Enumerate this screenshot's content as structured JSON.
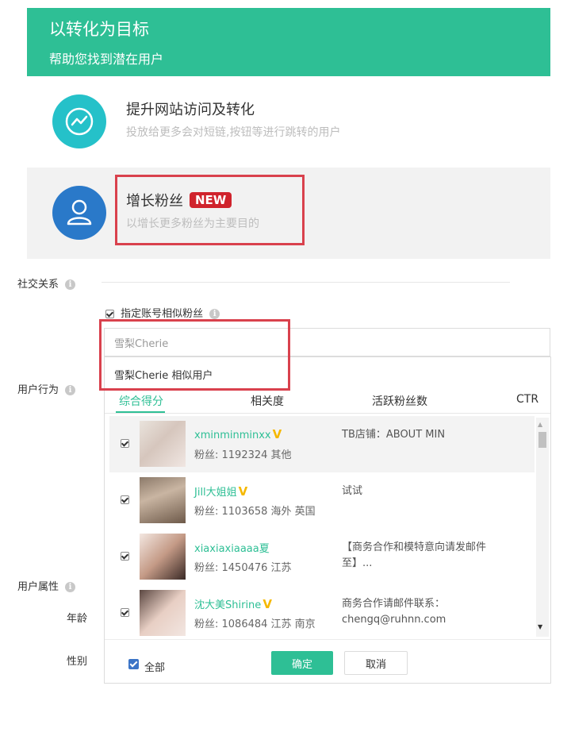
{
  "goal": {
    "title": "以转化为目标",
    "subtitle": "帮助您找到潜在用户",
    "options": [
      {
        "title": "提升网站访问及转化",
        "desc": "投放给更多会对短链,按钮等进行跳转的用户",
        "icon": "trend-icon",
        "color": "#25c1c9"
      },
      {
        "title": "增长粉丝",
        "badge": "NEW",
        "desc": "以增长更多粉丝为主要目的",
        "icon": "user-icon",
        "color": "#2a79c9",
        "selected": true
      }
    ]
  },
  "form": {
    "social_label": "社交关系",
    "behavior_label": "用户行为",
    "attr_label": "用户属性",
    "age_label": "年龄",
    "gender_label": "性别",
    "similar_checkbox_label": "指定账号相似粉丝",
    "search_value": "雪梨Cherie",
    "suggestion": "雪梨Cherie 相似用户"
  },
  "dropdown": {
    "columns": [
      "综合得分",
      "相关度",
      "活跃粉丝数",
      "CTR"
    ],
    "active_column": "综合得分",
    "rows": [
      {
        "name": "xminminminxx",
        "verified": true,
        "fans": "粉丝: 1192324 其他",
        "desc": "TB店铺：ABOUT MIN",
        "checked": true
      },
      {
        "name": "Jill大姐姐",
        "verified": true,
        "fans": "粉丝: 1103658 海外 英国",
        "desc": "试试",
        "checked": true
      },
      {
        "name": "xiaxiaxiaaaa夏",
        "verified": false,
        "fans": "粉丝: 1450476 江苏",
        "desc": "【商务合作和模特意向请发邮件至】...",
        "checked": true
      },
      {
        "name": "沈大美Shirine",
        "verified": true,
        "fans": "粉丝: 1086484 江苏 南京",
        "desc": "商务合作请邮件联系：chengq@ruhnn.com",
        "checked": true
      }
    ],
    "select_all_label": "全部",
    "ok_label": "确定",
    "cancel_label": "取消"
  },
  "colors": {
    "accent": "#2ebf95",
    "highlight_box": "#d9414d",
    "verified": "#f5b800",
    "new_badge": "#d0232c"
  }
}
